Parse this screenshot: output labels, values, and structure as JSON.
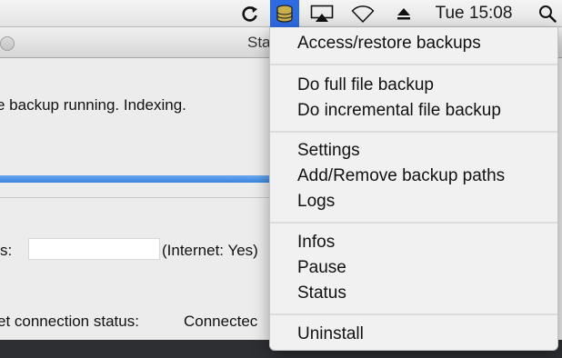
{
  "menubar": {
    "clock": "Tue 15:08",
    "icons": [
      "refresh-icon",
      "backup-app-icon",
      "airplay-icon",
      "wifi-icon",
      "eject-icon",
      "spotlight-search-icon"
    ],
    "accent_color": "#2d6be0"
  },
  "window": {
    "title": "Sta",
    "status_text": "e backup running. Indexing.",
    "ip_label": "s:",
    "internet_status": "(Internet: Yes)",
    "connection_label": "et connection status:",
    "connection_value": "Connectec"
  },
  "menu": {
    "items": [
      "Access/restore backups",
      "Do full file backup",
      "Do incremental file backup",
      "Settings",
      "Add/Remove backup paths",
      "Logs",
      "Infos",
      "Pause",
      "Status",
      "Uninstall"
    ]
  }
}
